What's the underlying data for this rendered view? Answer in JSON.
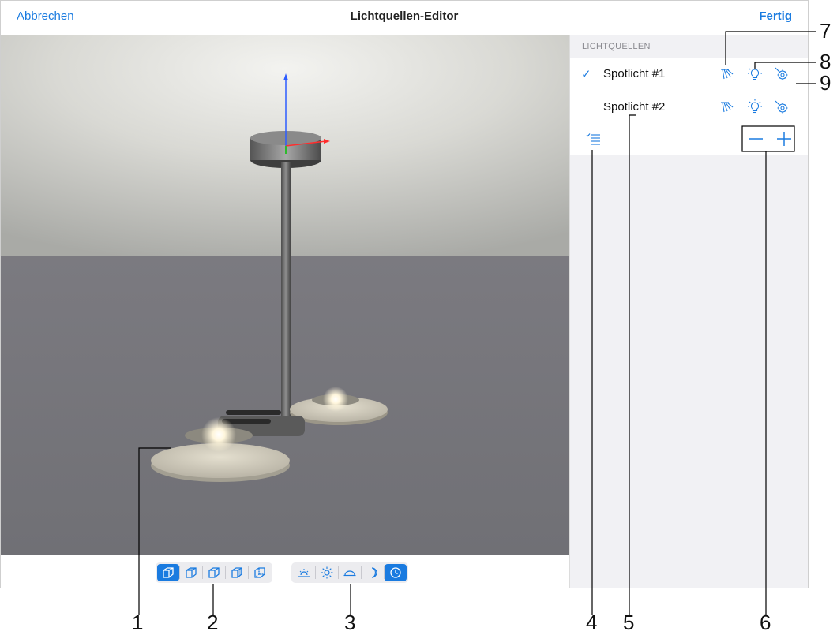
{
  "navbar": {
    "cancel_label": "Abbrechen",
    "title": "Lichtquellen-Editor",
    "done_label": "Fertig"
  },
  "sidebar": {
    "section_header": "LICHTQUELLEN",
    "lights": [
      {
        "name": "Spotlicht #1",
        "selected": true
      },
      {
        "name": "Spotlicht #2",
        "selected": false
      }
    ],
    "selected_mark": "✓"
  },
  "callouts": [
    "1",
    "2",
    "3",
    "4",
    "5",
    "6",
    "7",
    "8",
    "9"
  ],
  "colors": {
    "accent": "#1a7be0",
    "viewport_floor": "#76757a",
    "ceiling": "#ecece8"
  },
  "icons": {
    "view_modes": [
      "cube-view-front-icon",
      "cube-view-top-icon",
      "cube-view-side-icon",
      "cube-view-right-icon",
      "cube-view-back-icon"
    ],
    "light_modes": [
      "sunrise-icon",
      "sun-icon",
      "dusk-icon",
      "moon-icon",
      "clock-icon"
    ],
    "row_icons": [
      "light-rays-icon",
      "bulb-icon",
      "wrench-gear-icon"
    ]
  }
}
